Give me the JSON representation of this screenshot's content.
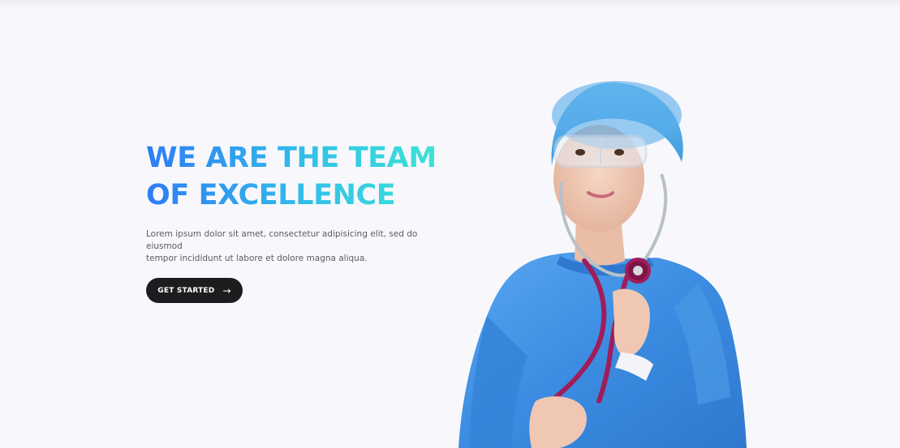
{
  "hero": {
    "title_line1": "WE ARE THE TEAM",
    "title_line2": "OF EXCELLENCE",
    "description_line1": "Lorem ipsum dolor sit amet, consectetur adipisicing elit, sed do eiusmod",
    "description_line2": "tempor incididunt ut labore et dolore magna aliqua.",
    "cta_label": "GET STARTED",
    "cta_icon": "arrow-right-icon",
    "image_subject": "doctor-with-stethoscope"
  },
  "colors": {
    "gradient_start": "#2d7cf6",
    "gradient_end": "#3ee6d2",
    "button_bg": "#1d1d1f",
    "page_bg": "#f8f8fc",
    "scrubs": "#3f8fe3",
    "stethoscope": "#a01d5a"
  }
}
